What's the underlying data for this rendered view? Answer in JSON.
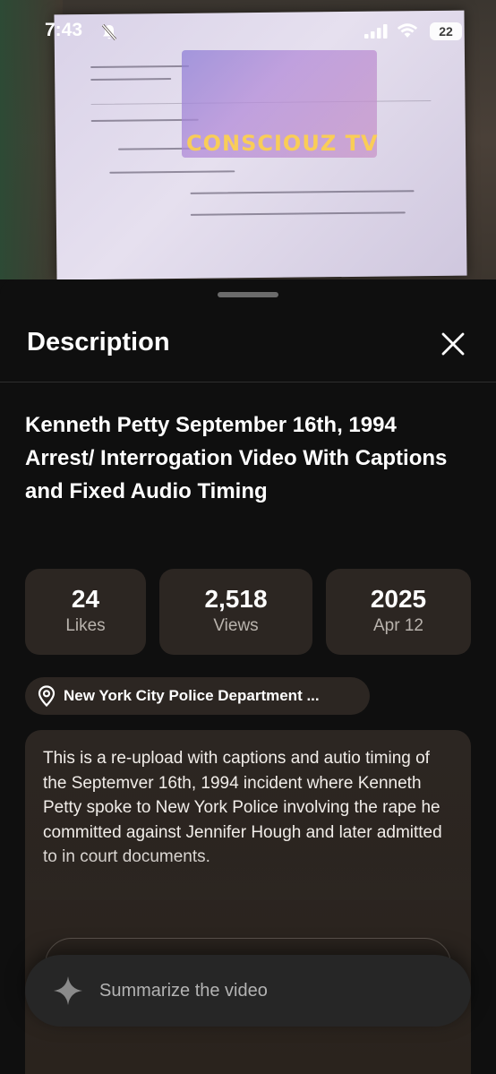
{
  "status_bar": {
    "time": "7:43",
    "battery": "22"
  },
  "video": {
    "watermark_text": "CONSCIOUZ TV"
  },
  "sheet": {
    "title": "Description",
    "video_title": "Kenneth Petty September 16th, 1994 Arrest/ Interrogation Video With Captions and Fixed Audio Timing",
    "stats": [
      {
        "value": "24",
        "label": "Likes"
      },
      {
        "value": "2,518",
        "label": "Views"
      },
      {
        "value": "2025",
        "label": "Apr 12"
      }
    ],
    "location": "New York City Police Department ...",
    "description": "This is a re-upload with captions and autio timing of the Septemver 16th, 1994 incident where Kenneth Petty spoke to New York Police involving the rape he committed against Jennifer Hough and later admitted to in court documents.",
    "summarize_label": "Summarize the video"
  },
  "colors": {
    "background": "#0f0f0f",
    "card": "#2c2622",
    "muted_text": "#b9b3ad"
  },
  "icons": [
    "bell-slash-icon",
    "signal-icon",
    "wifi-icon",
    "battery-icon",
    "close-icon",
    "location-pin-icon",
    "sparkle-icon"
  ]
}
